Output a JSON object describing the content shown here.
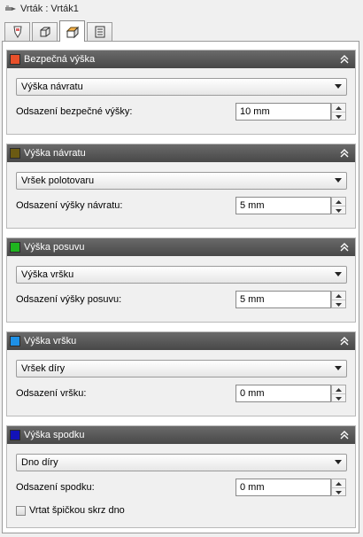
{
  "window": {
    "title": "Vrták : Vrták1",
    "icon": "drill-icon"
  },
  "tabs": [
    {
      "icon": "tool-icon",
      "active": false
    },
    {
      "icon": "box-icon",
      "active": false
    },
    {
      "icon": "heights-icon",
      "active": true
    },
    {
      "icon": "linking-icon",
      "active": false
    }
  ],
  "groups": {
    "safe": {
      "title": "Bezpečná výška",
      "color": "#e8502a",
      "select": "Výška návratu",
      "field_label": "Odsazení bezpečné výšky:",
      "field_value": "10 mm"
    },
    "retract": {
      "title": "Výška návratu",
      "color": "#6b5a12",
      "select": "Vršek polotovaru",
      "field_label": "Odsazení výšky návratu:",
      "field_value": "5 mm"
    },
    "feed": {
      "title": "Výška posuvu",
      "color": "#1fb51f",
      "select": "Výška vršku",
      "field_label": "Odsazení výšky posuvu:",
      "field_value": "5 mm"
    },
    "top": {
      "title": "Výška vršku",
      "color": "#1e90e6",
      "select": "Vršek díry",
      "field_label": "Odsazení vršku:",
      "field_value": "0 mm"
    },
    "bottom": {
      "title": "Výška spodku",
      "color": "#1212b8",
      "select": "Dno díry",
      "field_label": "Odsazení spodku:",
      "field_value": "0 mm",
      "checkbox_label": "Vrtat špičkou skrz dno",
      "checkbox_checked": false
    }
  }
}
